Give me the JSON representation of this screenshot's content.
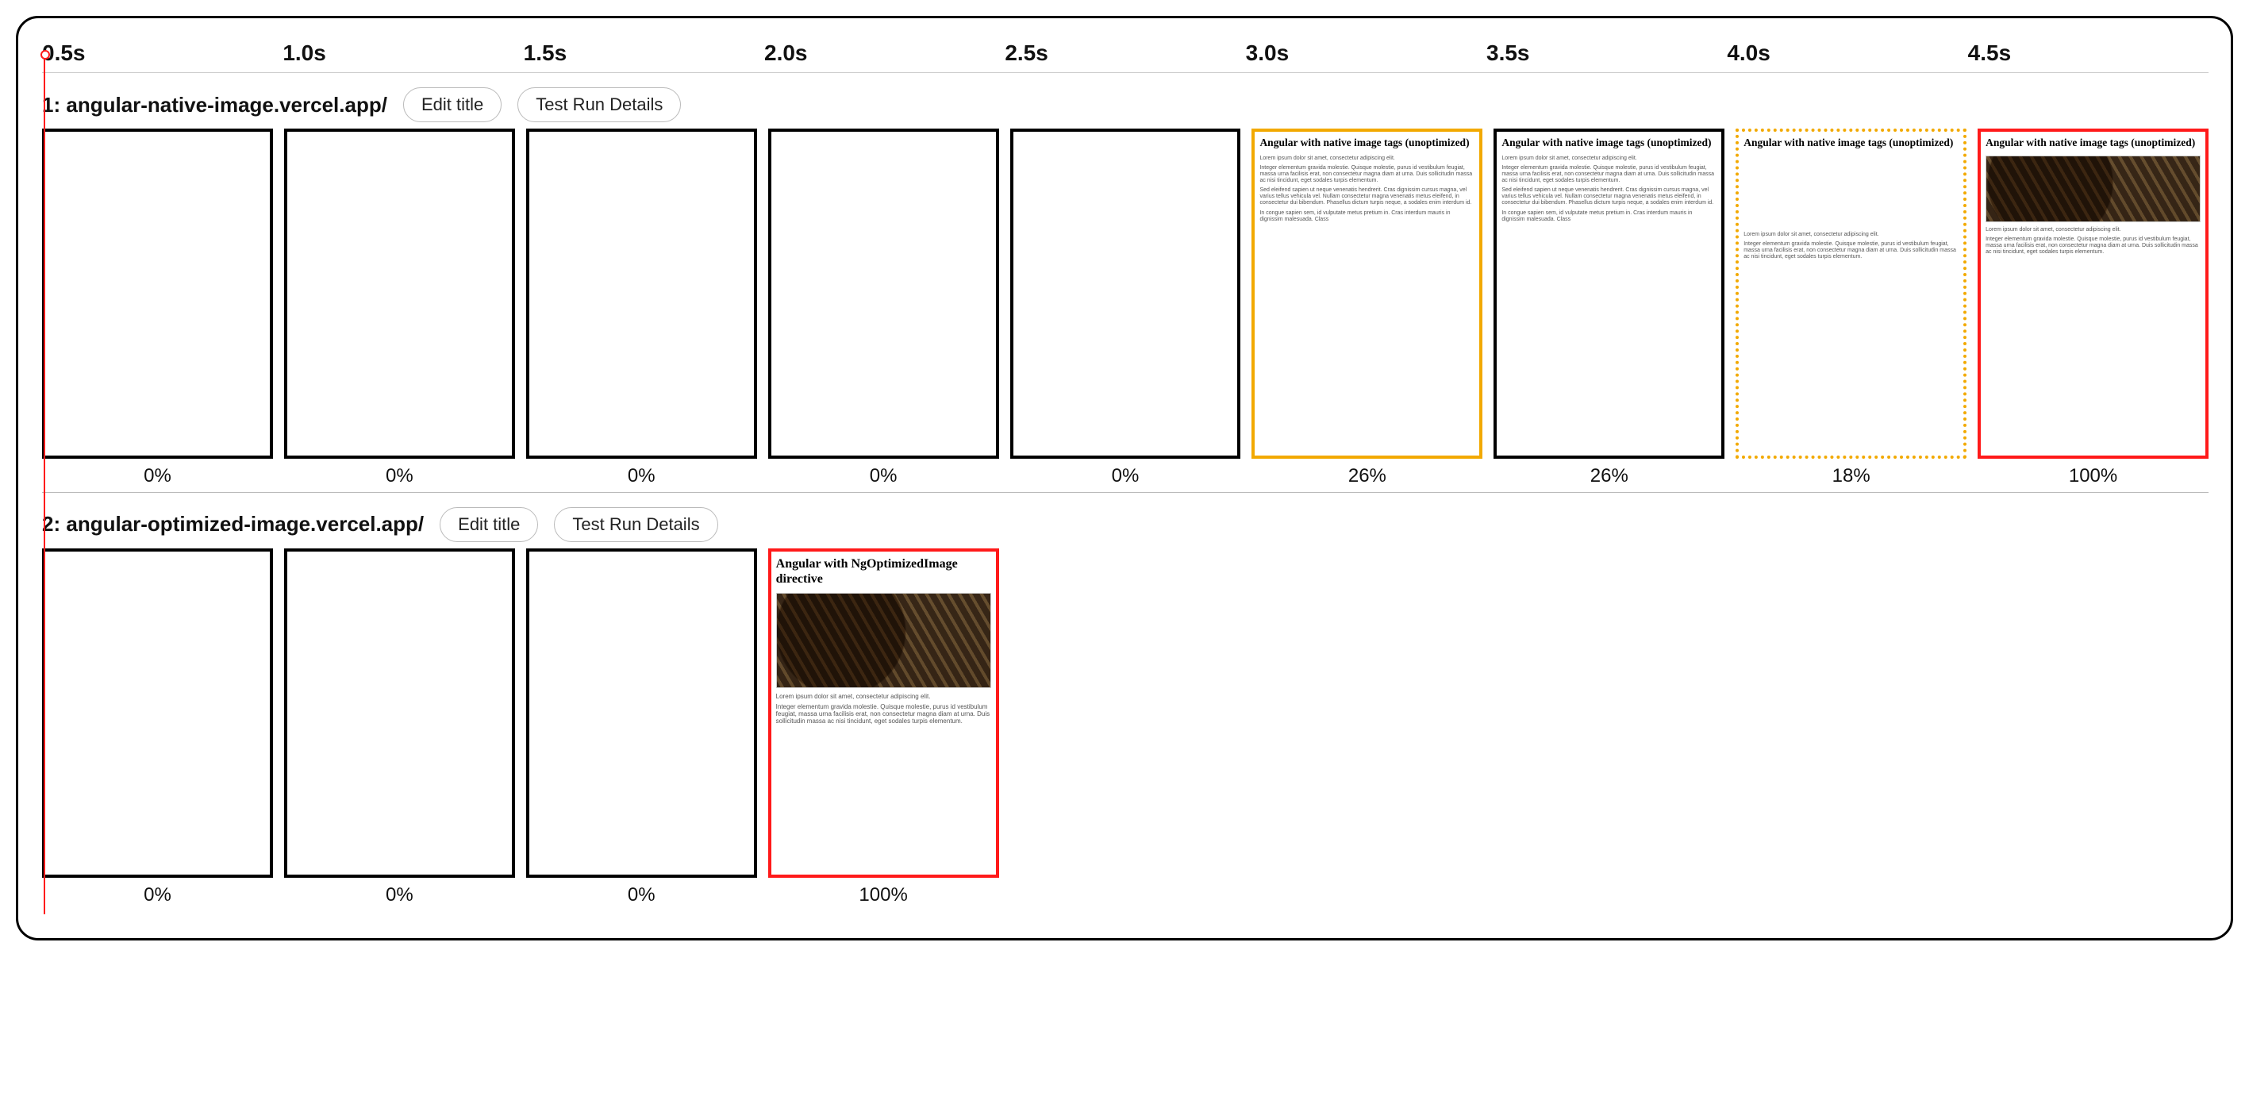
{
  "timeline": {
    "ticks": [
      "0.5s",
      "1.0s",
      "1.5s",
      "2.0s",
      "2.5s",
      "3.0s",
      "3.5s",
      "4.0s",
      "4.5s"
    ]
  },
  "buttons": {
    "edit_title": "Edit title",
    "test_run_details": "Test Run Details"
  },
  "runs": [
    {
      "index": "1",
      "title": "angular-native-image.vercel.app/",
      "frames": [
        {
          "pct": "0%",
          "style": "black",
          "content": "blank"
        },
        {
          "pct": "0%",
          "style": "black",
          "content": "blank"
        },
        {
          "pct": "0%",
          "style": "black",
          "content": "blank"
        },
        {
          "pct": "0%",
          "style": "black",
          "content": "blank"
        },
        {
          "pct": "0%",
          "style": "black",
          "content": "blank"
        },
        {
          "pct": "26%",
          "style": "yellow",
          "content": "native-text",
          "heading": "Angular with native image tags (unoptimized)"
        },
        {
          "pct": "26%",
          "style": "black",
          "content": "native-text",
          "heading": "Angular with native image tags (unoptimized)"
        },
        {
          "pct": "18%",
          "style": "yellow-dotted",
          "content": "native-dotted",
          "heading": "Angular with native image tags (unoptimized)"
        },
        {
          "pct": "100%",
          "style": "red",
          "content": "native-image",
          "heading": "Angular with native image tags (unoptimized)"
        }
      ]
    },
    {
      "index": "2",
      "title": "angular-optimized-image.vercel.app/",
      "frames": [
        {
          "pct": "0%",
          "style": "black",
          "content": "blank"
        },
        {
          "pct": "0%",
          "style": "black",
          "content": "blank"
        },
        {
          "pct": "0%",
          "style": "black",
          "content": "blank"
        },
        {
          "pct": "100%",
          "style": "red",
          "content": "optimized-image",
          "heading": "Angular with NgOptimizedImage directive"
        }
      ]
    }
  ],
  "lorem": {
    "p1": "Lorem ipsum dolor sit amet, consectetur adipiscing elit.",
    "p2": "Integer elementum gravida molestie. Quisque molestie, purus id vestibulum feugiat, massa urna facilisis erat, non consectetur magna diam at urna. Duis sollicitudin massa ac nisi tincidunt, eget sodales turpis elementum.",
    "p3": "Sed eleifend sapien ut neque venenatis hendrerit. Cras dignissim cursus magna, vel varius tellus vehicula vel. Nullam consectetur magna venenatis metus eleifend, in consectetur dui bibendum. Phasellus dictum turpis neque, a sodales enim interdum id.",
    "p4": "In congue sapien sem, id vulputate metus pretium in. Cras interdum mauris in dignissim malesuada. Class"
  }
}
